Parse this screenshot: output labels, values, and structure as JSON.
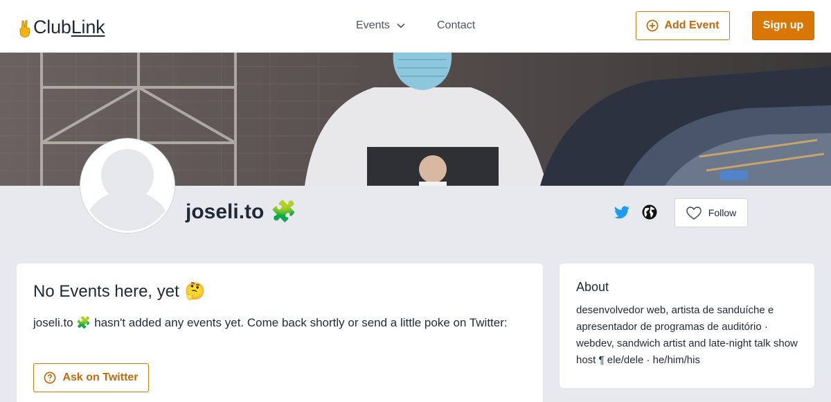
{
  "header": {
    "logo": "ClubLink",
    "logo_plain": "Club",
    "logo_link": "Link",
    "nav": {
      "events_label": "Events",
      "contact_label": "Contact"
    },
    "add_event_label": "Add Event",
    "signup_label": "Sign up"
  },
  "profile": {
    "username": "joseli.to",
    "username_emoji": "🧩",
    "follow_label": "Follow"
  },
  "events_card": {
    "title": "No Events here, yet",
    "title_emoji": "🤔",
    "message": "joseli.to 🧩 hasn't added any events yet. Come back shortly or send a little poke on Twitter:",
    "ask_button_label": "Ask on Twitter"
  },
  "about_card": {
    "title": "About",
    "text": "desenvolvedor web, artista de sanduíche e apresentador de programas de auditório · webdev, sandwich artist and late-night talk show host ¶ ele/dele · he/him/his"
  },
  "icons": {
    "logo": "peace-hand-icon",
    "events_dropdown": "chevron-down-icon",
    "add_event": "plus-circle-icon",
    "twitter": "twitter-icon",
    "website": "globe-icon",
    "follow": "heart-icon",
    "ask": "question-circle-icon"
  },
  "colors": {
    "accent": "#d97706",
    "accent_text": "#c2690b",
    "twitter": "#1d9bf0",
    "page_bg": "#e8e9ee"
  }
}
